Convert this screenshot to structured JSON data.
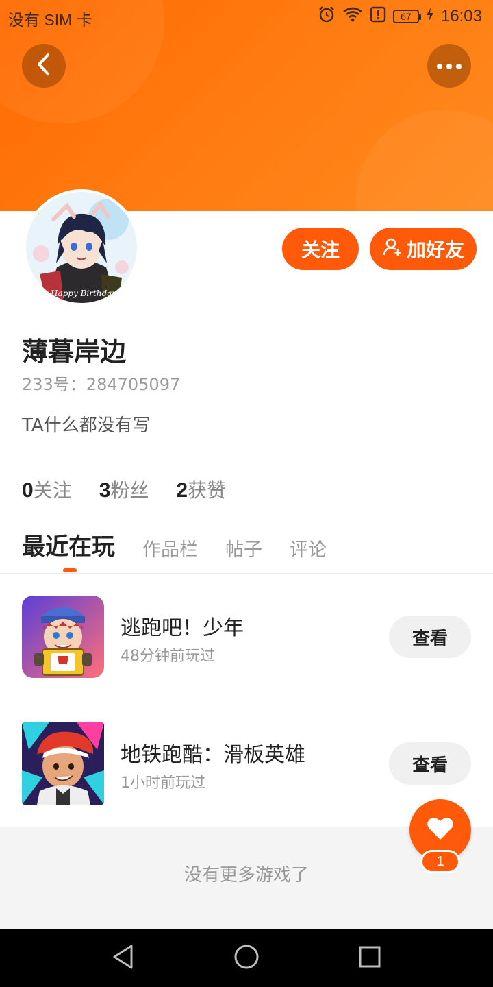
{
  "status_bar": {
    "carrier": "没有 SIM 卡",
    "battery": "67",
    "time": "16:03",
    "icons": [
      "alarm-icon",
      "wifi-icon",
      "alert-icon",
      "battery-icon",
      "charging-icon"
    ]
  },
  "colors": {
    "accent": "#ff5a0a",
    "header_gradient_start": "#ff6a00",
    "header_gradient_end": "#ff8a1e"
  },
  "profile": {
    "username": "薄暮岸边",
    "uid": "233号：284705097",
    "bio": "TA什么都没有写",
    "avatar_caption": "Happy Birthday"
  },
  "actions": {
    "follow_label": "关注",
    "add_friend_label": "加好友"
  },
  "stats": [
    {
      "num": "0",
      "label": "关注"
    },
    {
      "num": "3",
      "label": "粉丝"
    },
    {
      "num": "2",
      "label": "获赞"
    }
  ],
  "tabs": [
    {
      "label": "最近在玩",
      "active": true
    },
    {
      "label": "作品栏",
      "active": false
    },
    {
      "label": "帖子",
      "active": false
    },
    {
      "label": "评论",
      "active": false
    }
  ],
  "games": [
    {
      "name": "逃跑吧！少年",
      "time": "48分钟前玩过",
      "view_label": "查看"
    },
    {
      "name": "地铁跑酷：滑板英雄",
      "time": "1小时前玩过",
      "view_label": "查看"
    }
  ],
  "footer": {
    "no_more": "没有更多游戏了"
  },
  "like": {
    "count": "1"
  }
}
